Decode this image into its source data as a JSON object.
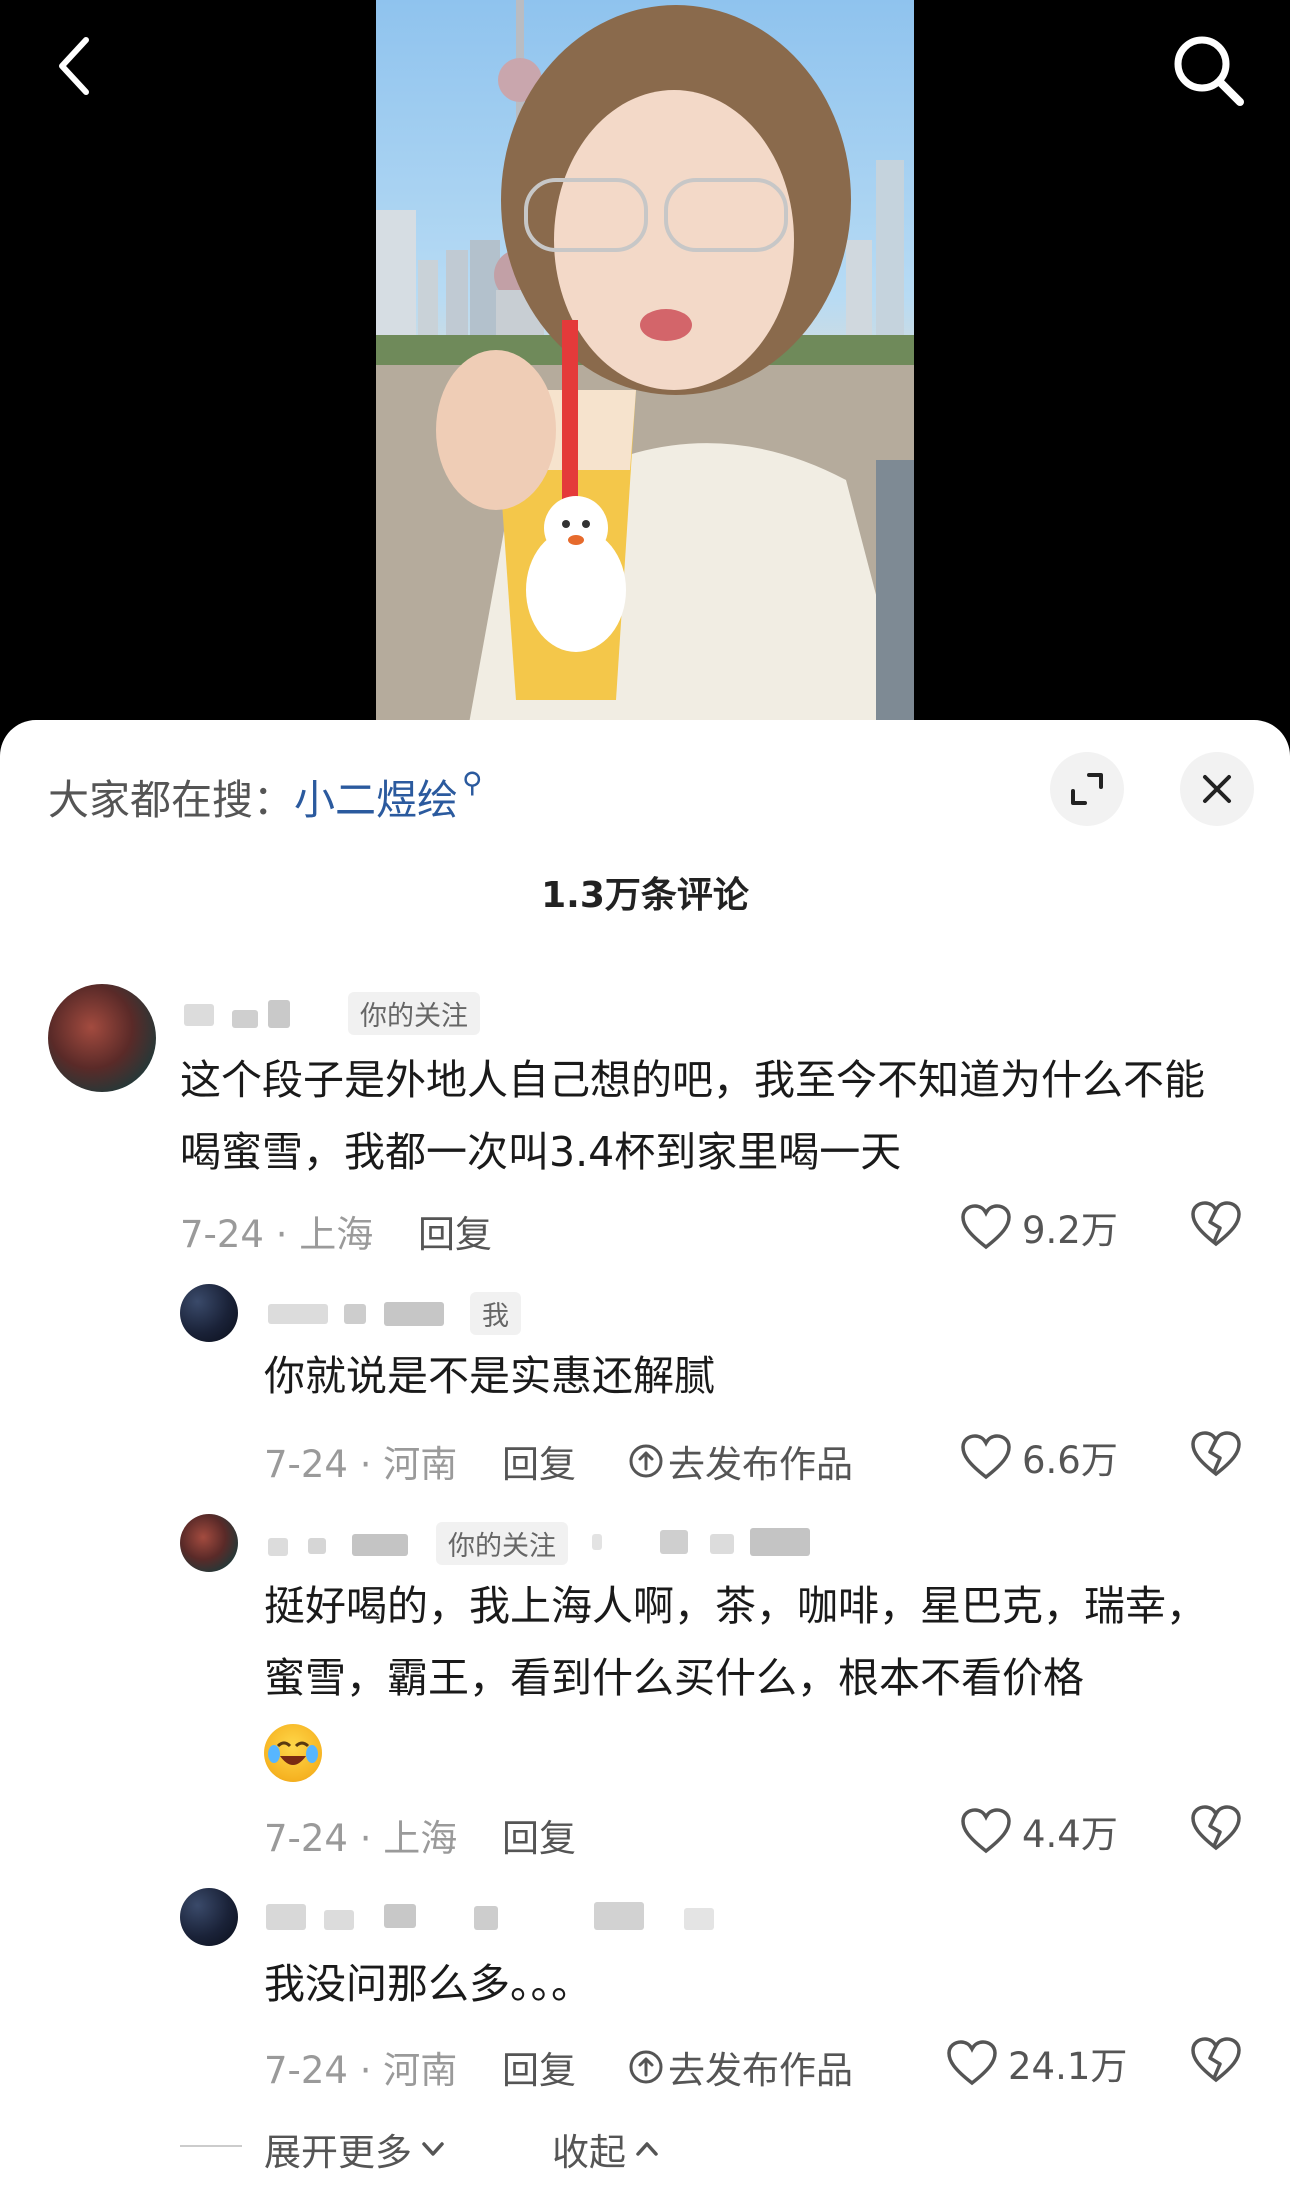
{
  "trending": {
    "prefix": "大家都在搜：",
    "keyword": "小二煜绘"
  },
  "comments_count_title": "1.3万条评论",
  "comments": [
    {
      "tag": "你的关注",
      "text": "这个段子是外地人自己想的吧，我至今不知道为什么不能喝蜜雪，我都一次叫3.4杯到家里喝一天",
      "date_loc": "7-24 · 上海",
      "reply": "回复",
      "likes": "9.2万"
    },
    {
      "tag": "我",
      "text": "你就说是不是实惠还解腻",
      "date_loc": "7-24 · 河南",
      "reply": "回复",
      "publish": "去发布作品",
      "likes": "6.6万"
    },
    {
      "tag": "你的关注",
      "text": "挺好喝的，我上海人啊，茶，咖啡，星巴克，瑞幸，蜜雪，霸王，看到什么买什么，根本不看价格",
      "date_loc": "7-24 · 上海",
      "reply": "回复",
      "likes": "4.4万"
    },
    {
      "text": "我没问那么多。。。",
      "date_loc": "7-24 · 河南",
      "reply": "回复",
      "publish": "去发布作品",
      "likes": "24.1万"
    }
  ],
  "footer": {
    "expand": "展开更多",
    "collapse": "收起"
  }
}
